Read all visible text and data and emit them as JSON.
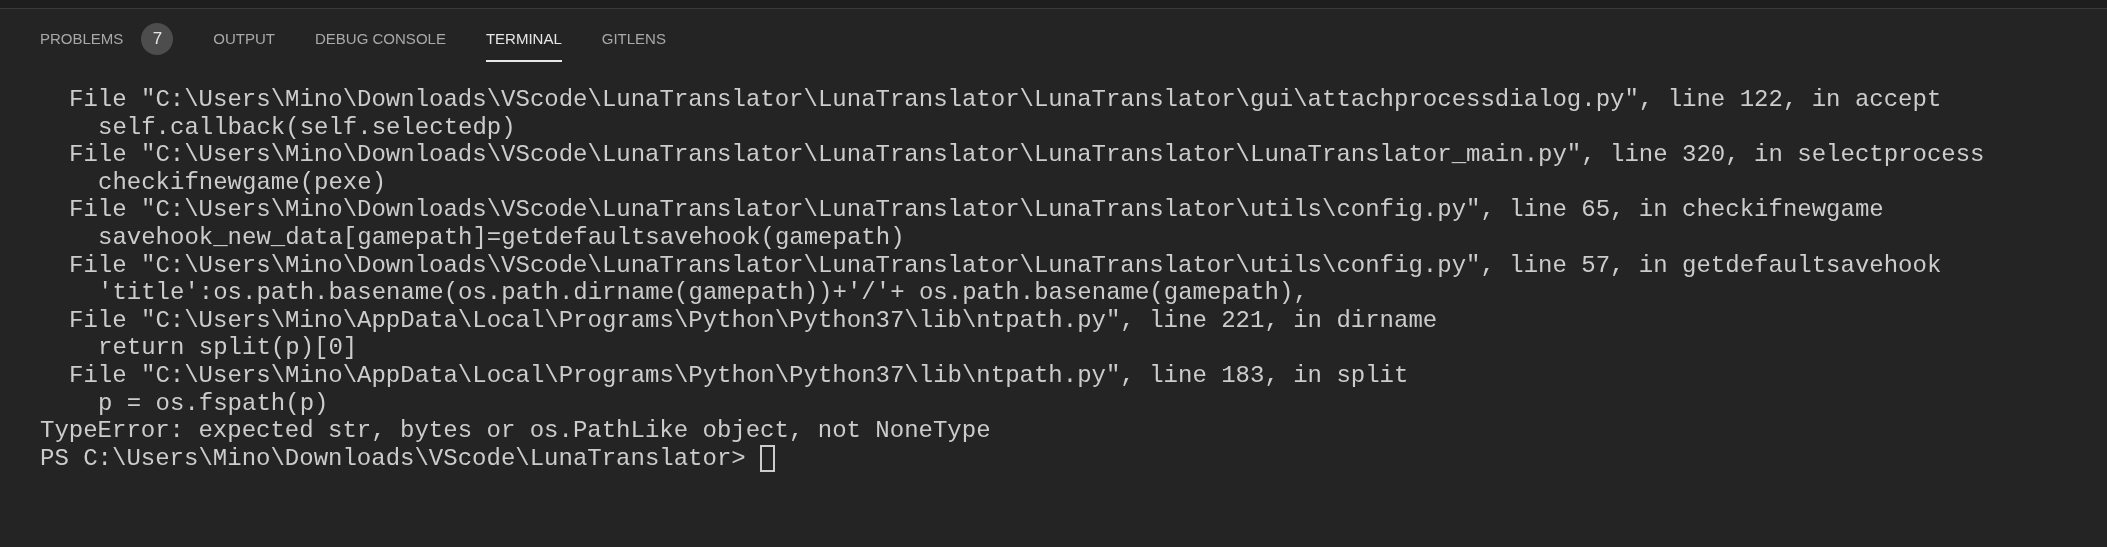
{
  "panel_tabs": [
    {
      "label": "PROBLEMS",
      "selected": false,
      "badge": "7"
    },
    {
      "label": "OUTPUT",
      "selected": false
    },
    {
      "label": "DEBUG CONSOLE",
      "selected": false
    },
    {
      "label": "TERMINAL",
      "selected": true
    },
    {
      "label": "GITLENS",
      "selected": false
    }
  ],
  "terminal": {
    "lines": [
      {
        "kind": "frame",
        "text": "File \"C:\\Users\\Mino\\Downloads\\VScode\\LunaTranslator\\LunaTranslator\\LunaTranslator\\gui\\attachprocessdialog.py\", line 122, in accept"
      },
      {
        "kind": "code",
        "text": "self.callback(self.selectedp)"
      },
      {
        "kind": "frame",
        "text": "File \"C:\\Users\\Mino\\Downloads\\VScode\\LunaTranslator\\LunaTranslator\\LunaTranslator\\LunaTranslator_main.py\", line 320, in selectprocess"
      },
      {
        "kind": "code",
        "text": "checkifnewgame(pexe)"
      },
      {
        "kind": "frame",
        "text": "File \"C:\\Users\\Mino\\Downloads\\VScode\\LunaTranslator\\LunaTranslator\\LunaTranslator\\utils\\config.py\", line 65, in checkifnewgame"
      },
      {
        "kind": "code",
        "text": "savehook_new_data[gamepath]=getdefaultsavehook(gamepath)"
      },
      {
        "kind": "frame",
        "text": "File \"C:\\Users\\Mino\\Downloads\\VScode\\LunaTranslator\\LunaTranslator\\LunaTranslator\\utils\\config.py\", line 57, in getdefaultsavehook"
      },
      {
        "kind": "code",
        "text": "'title':os.path.basename(os.path.dirname(gamepath))+'/'+ os.path.basename(gamepath),"
      },
      {
        "kind": "frame",
        "text": "File \"C:\\Users\\Mino\\AppData\\Local\\Programs\\Python\\Python37\\lib\\ntpath.py\", line 221, in dirname"
      },
      {
        "kind": "code",
        "text": "return split(p)[0]"
      },
      {
        "kind": "frame",
        "text": "File \"C:\\Users\\Mino\\AppData\\Local\\Programs\\Python\\Python37\\lib\\ntpath.py\", line 183, in split"
      },
      {
        "kind": "code",
        "text": "p = os.fspath(p)"
      },
      {
        "kind": "error",
        "text": "TypeError: expected str, bytes or os.PathLike object, not NoneType"
      }
    ],
    "prompt": "PS C:\\Users\\Mino\\Downloads\\VScode\\LunaTranslator>"
  }
}
